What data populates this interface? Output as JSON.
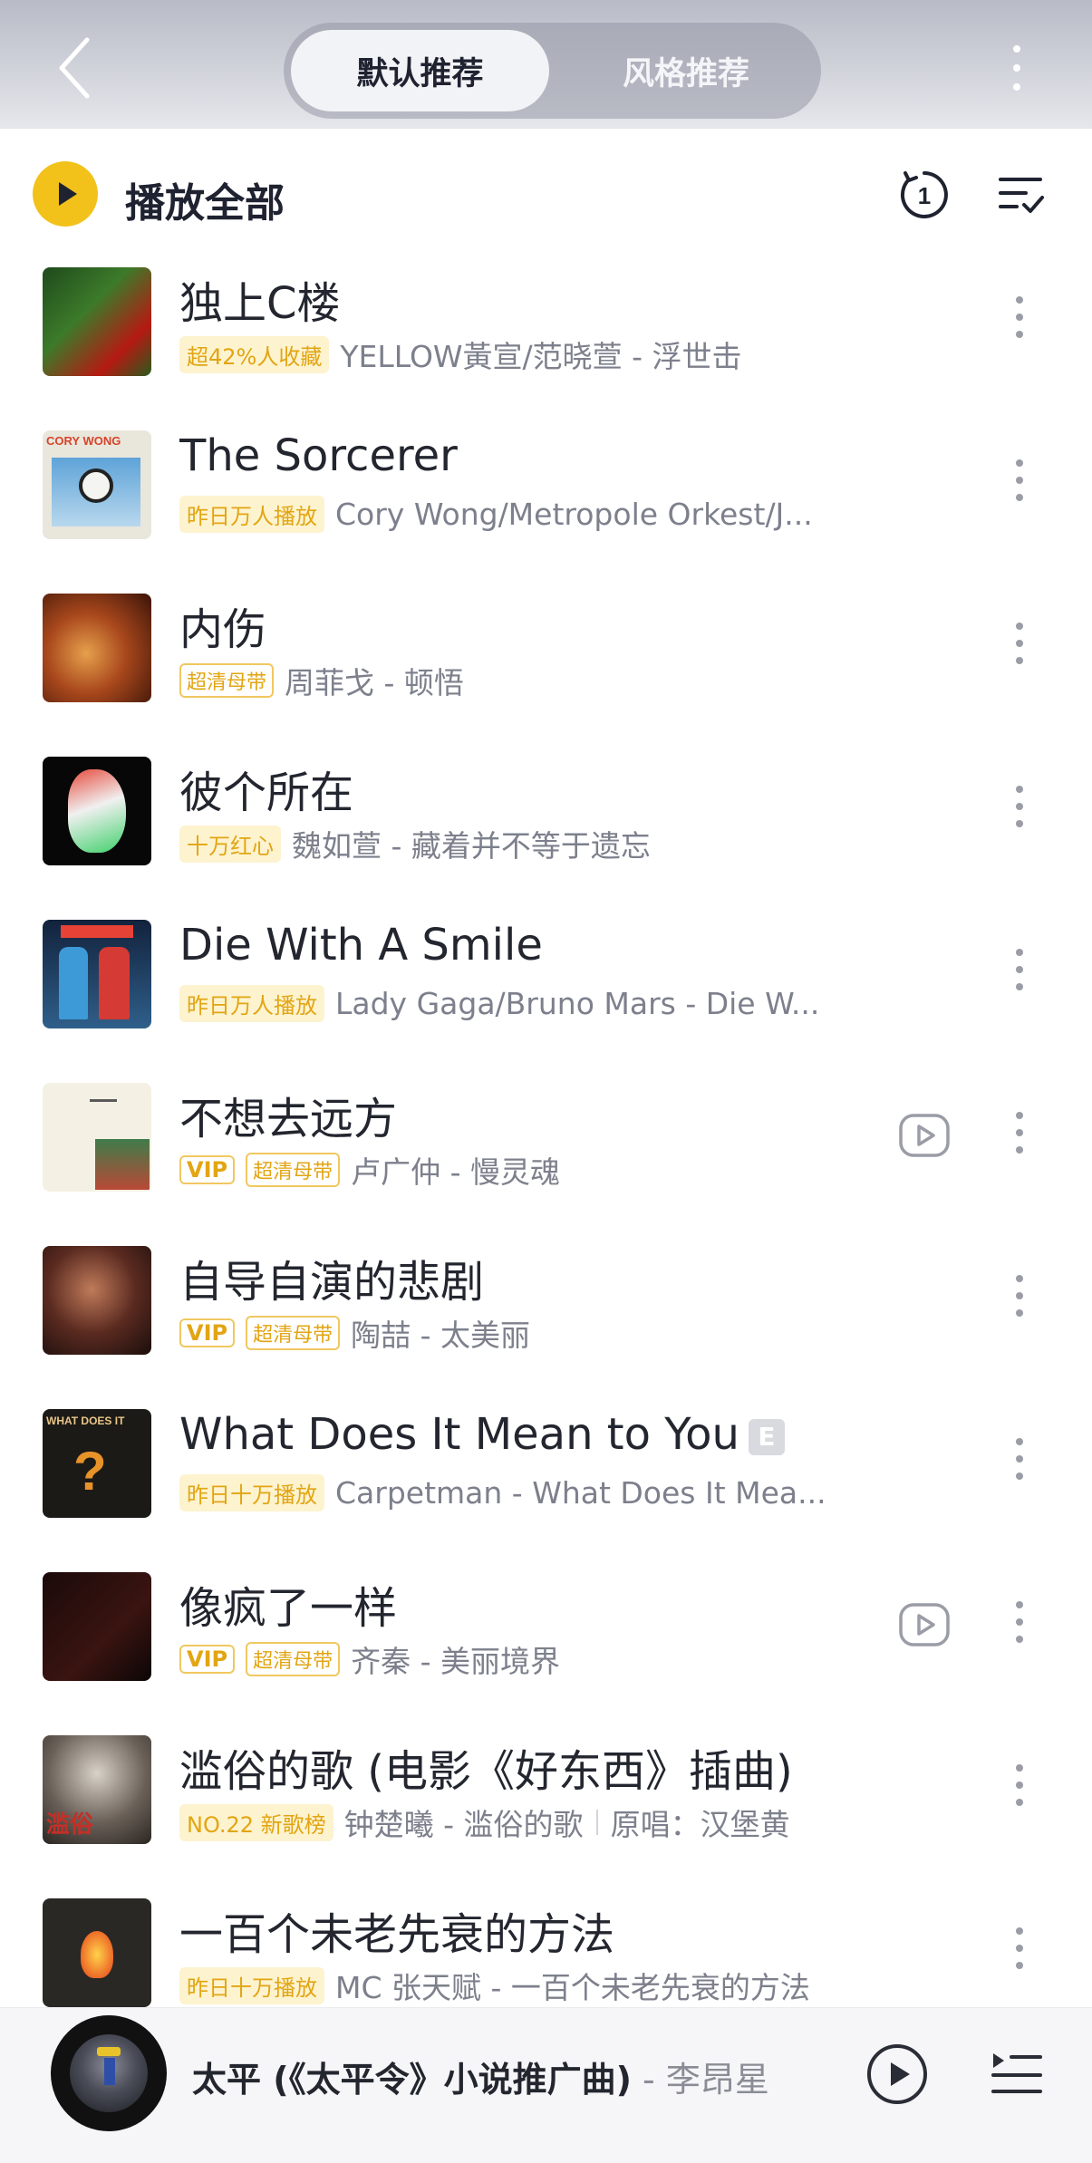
{
  "header": {
    "tab_default": "默认推荐",
    "tab_style": "风格推荐"
  },
  "toolbar": {
    "play_all": "播放全部",
    "loop_badge": "1"
  },
  "songs": [
    {
      "title": "独上C楼",
      "tags": [
        {
          "text": "超42%人收藏",
          "style": "fill"
        }
      ],
      "artist_album": "YELLOW黃宣/范晓萱 - 浮世击",
      "has_mv": false,
      "cover": "forest"
    },
    {
      "title": "The Sorcerer",
      "tags": [
        {
          "text": "昨日万人播放",
          "style": "fill"
        }
      ],
      "artist_album": "Cory Wong/Metropole Orkest/J...",
      "has_mv": false,
      "cover": "cory"
    },
    {
      "title": "内伤",
      "tags": [
        {
          "text": "超清母带",
          "style": "line"
        }
      ],
      "artist_album": "周菲戈 - 顿悟",
      "has_mv": false,
      "cover": "orange"
    },
    {
      "title": "彼个所在",
      "tags": [
        {
          "text": "十万红心",
          "style": "fill"
        }
      ],
      "artist_album": "魏如萱 - 藏着并不等于遗忘",
      "has_mv": false,
      "cover": "profile"
    },
    {
      "title": "Die With A Smile",
      "tags": [
        {
          "text": "昨日万人播放",
          "style": "fill"
        }
      ],
      "artist_album": "Lady Gaga/Bruno Mars - Die W...",
      "has_mv": false,
      "cover": "gaga"
    },
    {
      "title": "不想去远方",
      "tags": [
        {
          "text": "VIP",
          "style": "vip"
        },
        {
          "text": "超清母带",
          "style": "line"
        }
      ],
      "artist_album": "卢广仲 - 慢灵魂",
      "has_mv": true,
      "cover": "cream"
    },
    {
      "title": "自导自演的悲剧",
      "tags": [
        {
          "text": "VIP",
          "style": "vip"
        },
        {
          "text": "超清母带",
          "style": "line"
        }
      ],
      "artist_album": "陶喆 - 太美丽",
      "has_mv": false,
      "cover": "portrait"
    },
    {
      "title": "What Does It Mean to You",
      "explicit": "E",
      "tags": [
        {
          "text": "昨日十万播放",
          "style": "fill"
        }
      ],
      "artist_album": "Carpetman - What Does It Mea...",
      "has_mv": false,
      "cover": "question"
    },
    {
      "title": "像疯了一样",
      "tags": [
        {
          "text": "VIP",
          "style": "vip"
        },
        {
          "text": "超清母带",
          "style": "line"
        }
      ],
      "artist_album": "齐秦 - 美丽境界",
      "has_mv": true,
      "cover": "dark"
    },
    {
      "title": "滥俗的歌 (电影《好东西》插曲)",
      "tags": [
        {
          "text": "NO.22 新歌榜",
          "style": "fill"
        }
      ],
      "artist_album": "钟楚曦 - 滥俗的歌",
      "original": "原唱：汉堡黄",
      "has_mv": false,
      "cover": "girl"
    },
    {
      "title": "一百个未老先衰的方法",
      "tags": [
        {
          "text": "昨日十万播放",
          "style": "fill"
        }
      ],
      "artist_album": "MC 张天赋 - 一百个未老先衰的方法",
      "has_mv": false,
      "cover": "fire"
    }
  ],
  "now_playing": {
    "title": "太平 (《太平令》小说推广曲)",
    "artist": " - 李昂星"
  },
  "colors": {
    "accent_yellow": "#f2c21b",
    "tag_text": "#e2a513",
    "tag_bg": "#fdf3cf"
  }
}
